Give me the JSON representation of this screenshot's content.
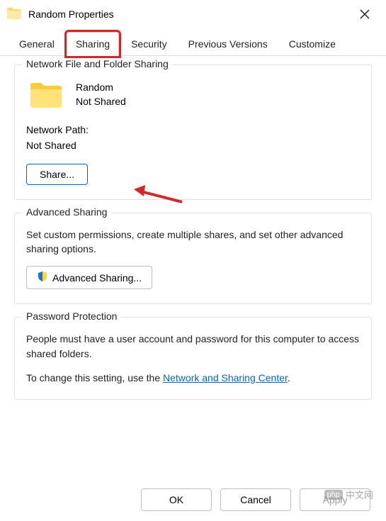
{
  "title": "Random Properties",
  "tabs": {
    "general": "General",
    "sharing": "Sharing",
    "security": "Security",
    "previous": "Previous Versions",
    "customize": "Customize"
  },
  "network_sharing": {
    "legend": "Network File and Folder Sharing",
    "folder_name": "Random",
    "folder_status": "Not Shared",
    "path_label": "Network Path:",
    "path_value": "Not Shared",
    "share_button": "Share..."
  },
  "advanced_sharing": {
    "legend": "Advanced Sharing",
    "description": "Set custom permissions, create multiple shares, and set other advanced sharing options.",
    "button": "Advanced Sharing..."
  },
  "password_protection": {
    "legend": "Password Protection",
    "line1": "People must have a user account and password for this computer to access shared folders.",
    "line2_prefix": "To change this setting, use the ",
    "link": "Network and Sharing Center",
    "line2_suffix": "."
  },
  "footer": {
    "ok": "OK",
    "cancel": "Cancel",
    "apply": "Apply"
  },
  "watermark": "中文网"
}
